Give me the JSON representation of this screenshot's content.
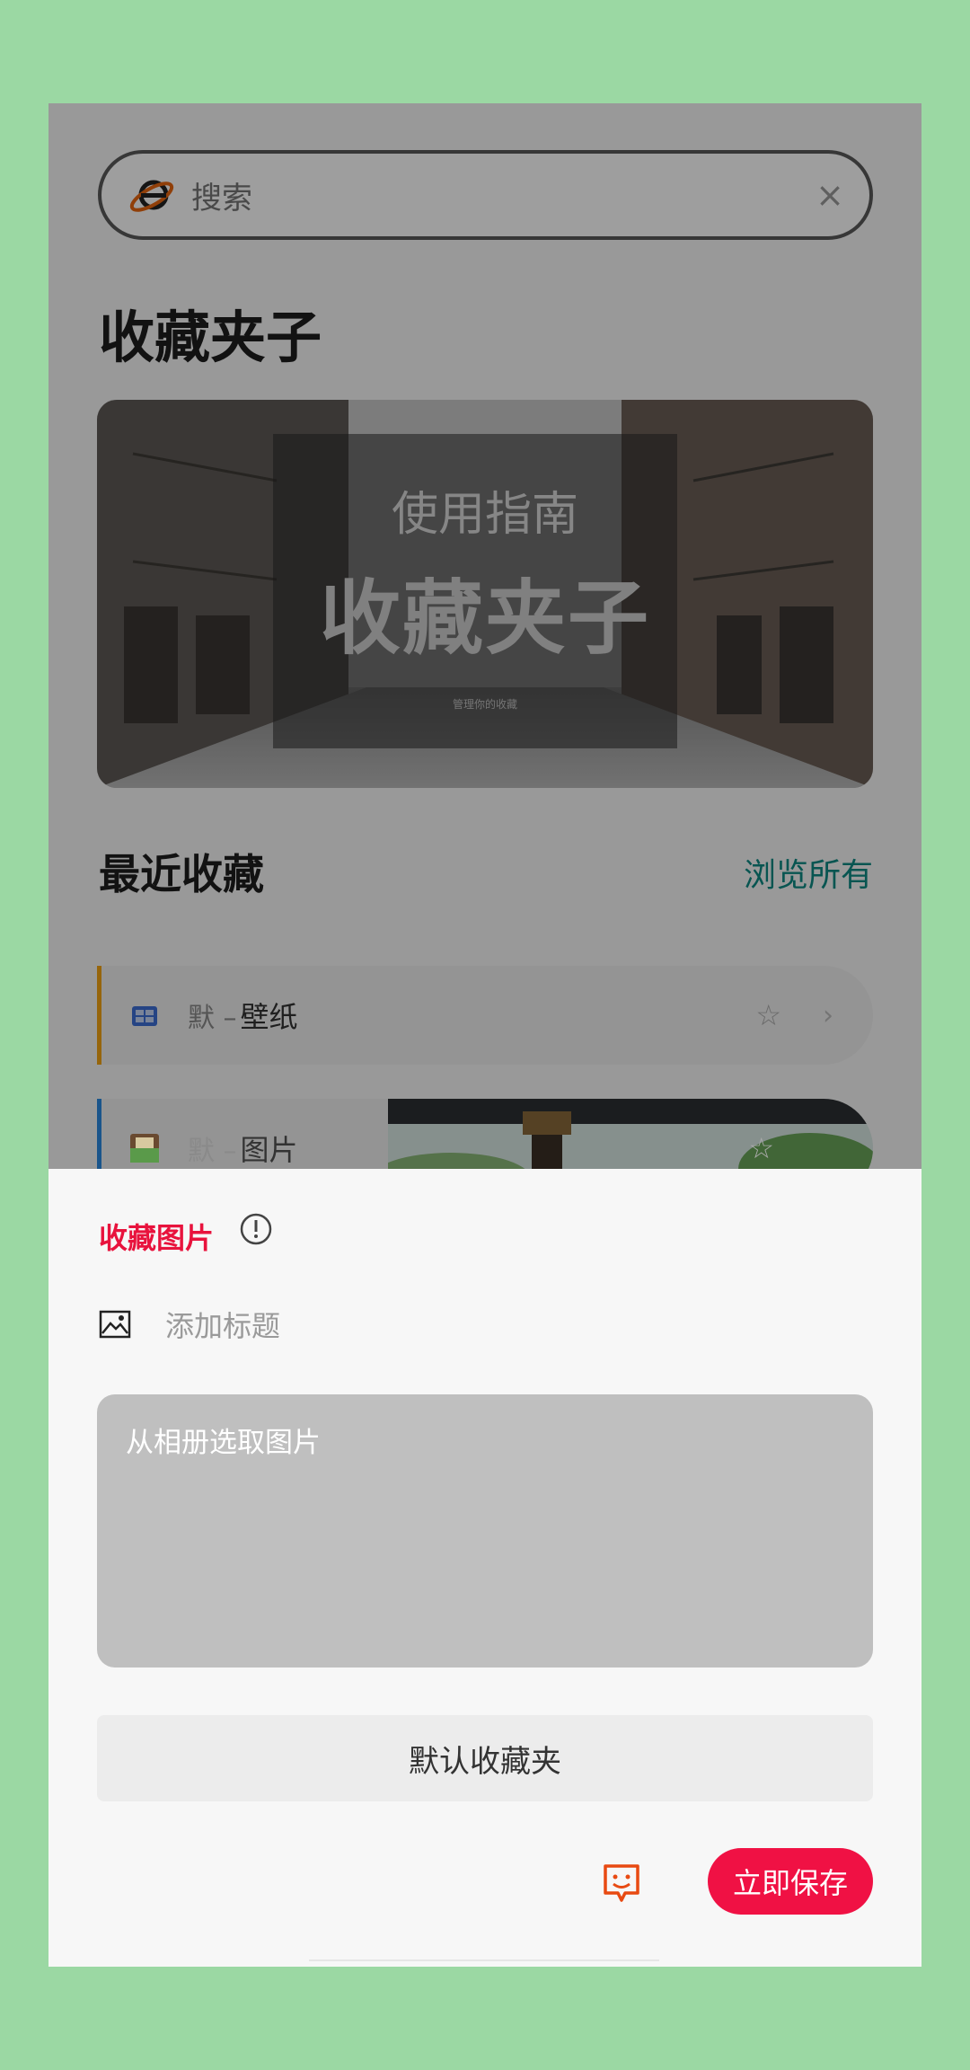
{
  "search": {
    "placeholder": "搜索",
    "clear_icon": "×"
  },
  "page_title": "收藏夹子",
  "banner": {
    "subtitle": "使用指南",
    "title": "收藏夹子",
    "caption": "管理你的收藏"
  },
  "recent": {
    "title": "最近收藏",
    "browse_all": "浏览所有",
    "items": [
      {
        "prefix": "默 –",
        "label": "壁纸",
        "accent": "#f3a312",
        "star": "☆",
        "chevron": "›"
      },
      {
        "prefix": "默 –",
        "label": "图片",
        "accent": "#2b8ae0",
        "star": "☆"
      }
    ]
  },
  "sheet": {
    "title": "收藏图片",
    "add_title_placeholder": "添加标题",
    "pick_hint": "从相册选取图片",
    "folder": "默认收藏夹",
    "save": "立即保存"
  },
  "colors": {
    "accent_red": "#f01144",
    "link_teal": "#0d8a84",
    "background": "#9bd8a3"
  }
}
